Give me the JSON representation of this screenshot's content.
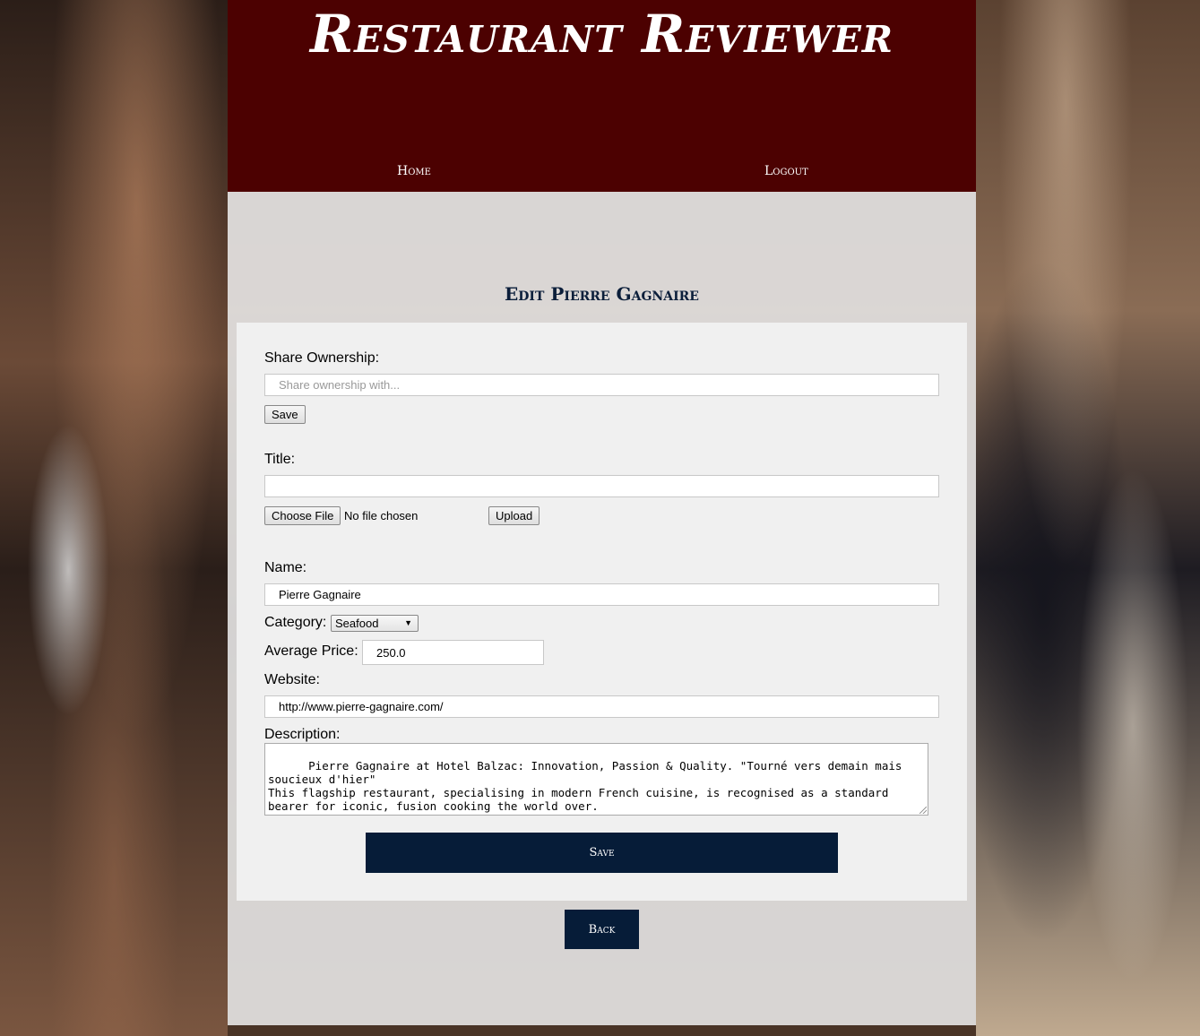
{
  "header": {
    "brand": "Restaurant Reviewer",
    "nav": {
      "home": "Home",
      "logout": "Logout"
    }
  },
  "page_title": "Edit Pierre Gagnaire",
  "form": {
    "share": {
      "label": "Share Ownership:",
      "placeholder": "Share ownership with...",
      "value": "",
      "save_label": "Save"
    },
    "title": {
      "label": "Title:",
      "value": "",
      "choose_file_label": "Choose File",
      "file_status": "No file chosen",
      "upload_label": "Upload"
    },
    "name": {
      "label": "Name:",
      "value": "Pierre Gagnaire"
    },
    "category": {
      "label": "Category:",
      "selected": "Seafood"
    },
    "price": {
      "label": "Average Price:",
      "value": "250.0"
    },
    "website": {
      "label": "Website:",
      "value": "http://www.pierre-gagnaire.com/"
    },
    "description": {
      "label": "Description:",
      "value": "Pierre Gagnaire at Hotel Balzac: Innovation, Passion & Quality. \"Tourné vers demain mais soucieux d'hier\"\nThis flagship restaurant, specialising in modern French cuisine, is recognised as a standard bearer for iconic, fusion cooking the world over."
    },
    "save_label": "Save"
  },
  "back_label": "Back",
  "colors": {
    "header_bg": "#4c0101",
    "primary_button": "#061c38",
    "title_text": "#0b1e3a"
  }
}
